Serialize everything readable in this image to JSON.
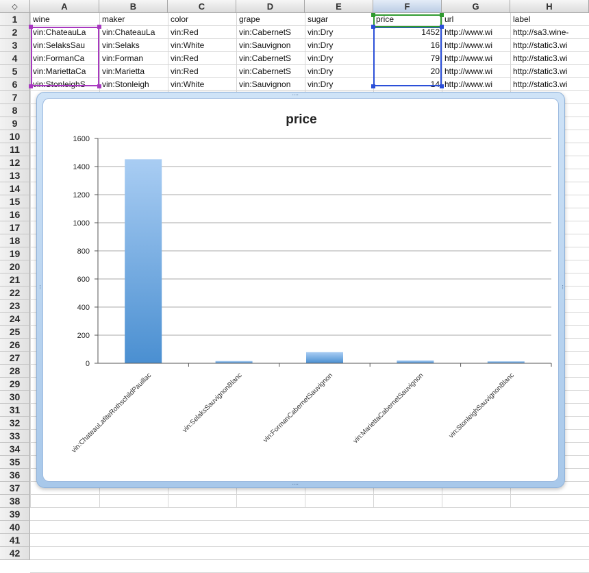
{
  "corner_glyph": "◇",
  "columns": [
    "A",
    "B",
    "C",
    "D",
    "E",
    "F",
    "G",
    "H"
  ],
  "selected_column": "F",
  "rows": [
    "1",
    "2",
    "3",
    "4",
    "5",
    "6",
    "7",
    "8",
    "9",
    "10",
    "11",
    "12",
    "13",
    "14",
    "15",
    "16",
    "17",
    "18",
    "19",
    "20",
    "21",
    "22",
    "23",
    "24",
    "25",
    "26",
    "27",
    "28",
    "29",
    "30",
    "31",
    "32",
    "33",
    "34",
    "35",
    "36",
    "37",
    "38",
    "39",
    "40",
    "41",
    "42"
  ],
  "cells": {
    "row1": [
      "wine",
      "maker",
      "color",
      "grape",
      "sugar",
      "price",
      "url",
      "label"
    ],
    "row2": [
      "vin:ChateauLa",
      "vin:ChateauLa",
      "vin:Red",
      "vin:CabernetS",
      "vin:Dry",
      "1452",
      "http://www.wi",
      "http://sa3.wine-"
    ],
    "row3": [
      "vin:SelaksSau",
      "vin:Selaks",
      "vin:White",
      "vin:Sauvignon",
      "vin:Dry",
      "16",
      "http://www.wi",
      "http://static3.wi"
    ],
    "row4": [
      "vin:FormanCa",
      "vin:Forman",
      "vin:Red",
      "vin:CabernetS",
      "vin:Dry",
      "79",
      "http://www.wi",
      "http://static3.wi"
    ],
    "row5": [
      "vin:MariettaCa",
      "vin:Marietta",
      "vin:Red",
      "vin:CabernetS",
      "vin:Dry",
      "20",
      "http://www.wi",
      "http://static3.wi"
    ],
    "row6": [
      "vin:StonleighS",
      "vin:Stonleigh",
      "vin:White",
      "vin:Sauvignon",
      "vin:Dry",
      "14",
      "http://www.wi",
      "http://static3.wi"
    ]
  },
  "colors": {
    "selection_a": "#a838c0",
    "selection_f": "#2b4fd8",
    "selection_header": "#2f9a2f",
    "bar_top": "#a9cdf3",
    "bar_bottom": "#4a8fd1"
  },
  "chart_data": {
    "type": "bar",
    "title": "price",
    "categories": [
      "vin:ChateauLafiteRothschildPauillac",
      "vin:SelaksSauvignonBlanc",
      "vin:FormanCabernetSauvignon",
      "vin:MariettaCabernetSauvignon",
      "vin:StonleighSauvignonBlanc"
    ],
    "values": [
      1452,
      16,
      79,
      20,
      14
    ],
    "ylim": [
      0,
      1600
    ],
    "yticks": [
      "0",
      "200",
      "400",
      "600",
      "800",
      "1000",
      "1200",
      "1400",
      "1600"
    ],
    "grid": true,
    "legend": "none"
  }
}
